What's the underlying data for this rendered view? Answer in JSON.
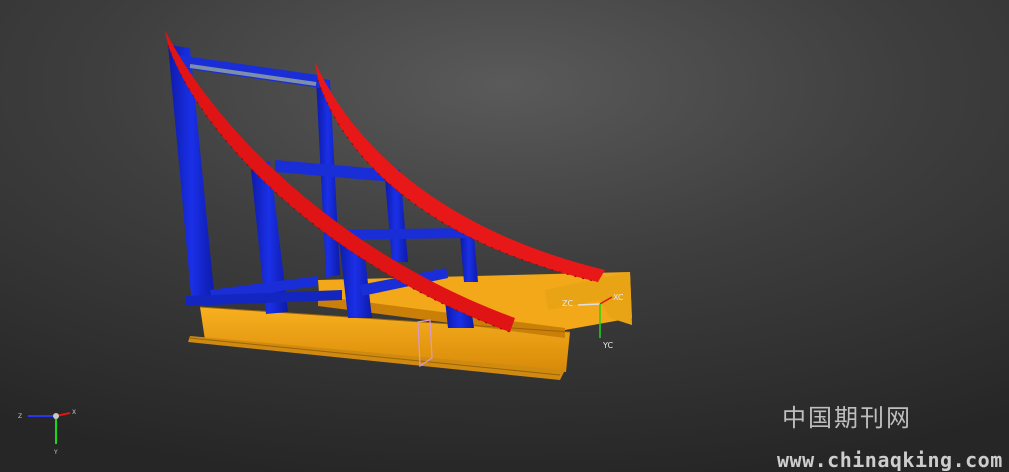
{
  "viewport": {
    "background_colors": [
      "#5a5a5a",
      "#262626"
    ],
    "model_colors": {
      "frame": "#1428d8",
      "rails": "#e81414",
      "base": "#f0a010",
      "edges": "#c87800"
    },
    "csys": {
      "zc_label": "ZC",
      "xc_label": "XC",
      "yc_label": "YC"
    },
    "view_triad": {
      "x_label": "X",
      "y_label": "Y",
      "z_label": "Z"
    }
  },
  "watermark": {
    "title": "中国期刊网",
    "url": "www.chinaqking.com"
  }
}
